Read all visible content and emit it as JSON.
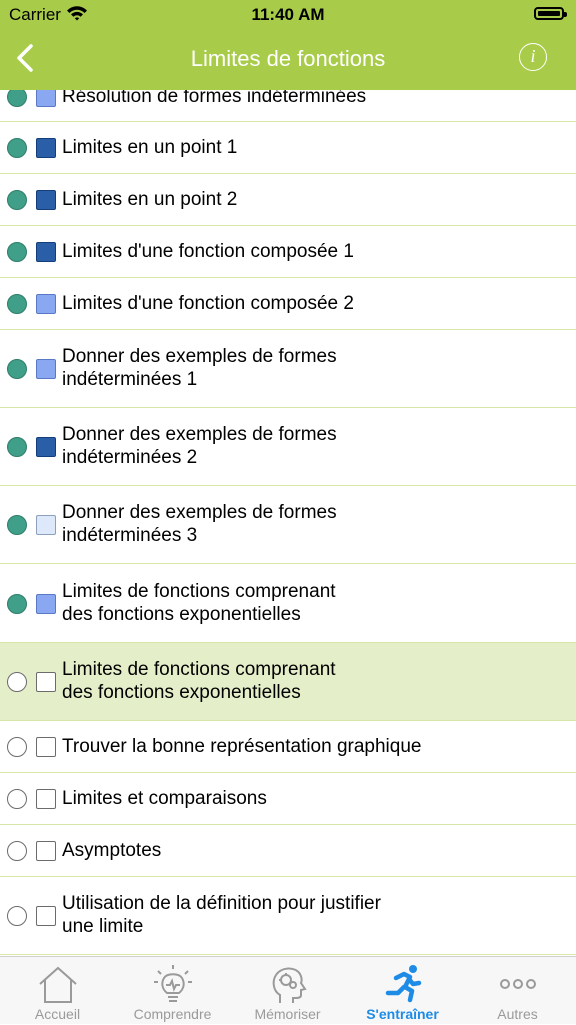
{
  "status_bar": {
    "carrier": "Carrier",
    "time": "11:40 AM"
  },
  "header": {
    "title": "Limites de fonctions",
    "back_icon": "chevron-left-icon",
    "info_icon": "info-icon"
  },
  "colors": {
    "header_bg": "#a8cc4a",
    "completed_dot": "#3f9f88",
    "selected_row_bg": "#e4efc9",
    "active_tab": "#1e8ce6",
    "inactive_tab": "#9a9a9a"
  },
  "items": [
    {
      "line1": "Résolution de formes indéterminées",
      "line2": "",
      "completed": true,
      "level": "medium",
      "selected": false
    },
    {
      "line1": "Limites en un point 1",
      "line2": "",
      "completed": true,
      "level": "dark",
      "selected": false
    },
    {
      "line1": "Limites en un point 2",
      "line2": "",
      "completed": true,
      "level": "dark",
      "selected": false
    },
    {
      "line1": "Limites d'une fonction composée 1",
      "line2": "",
      "completed": true,
      "level": "dark",
      "selected": false
    },
    {
      "line1": "Limites d'une fonction composée 2",
      "line2": "",
      "completed": true,
      "level": "medium",
      "selected": false
    },
    {
      "line1": "Donner des exemples de formes",
      "line2": "indéterminées 1",
      "completed": true,
      "level": "medium",
      "selected": false
    },
    {
      "line1": "Donner des exemples de formes",
      "line2": "indéterminées 2",
      "completed": true,
      "level": "dark",
      "selected": false
    },
    {
      "line1": "Donner des exemples de formes",
      "line2": "indéterminées 3",
      "completed": true,
      "level": "light",
      "selected": false
    },
    {
      "line1": "Limites de fonctions comprenant",
      "line2": "des fonctions exponentielles",
      "completed": true,
      "level": "medium",
      "selected": false
    },
    {
      "line1": "Limites de fonctions comprenant",
      "line2": "des fonctions exponentielles",
      "completed": false,
      "level": "empty",
      "selected": true
    },
    {
      "line1": "Trouver la bonne représentation graphique",
      "line2": "",
      "completed": false,
      "level": "empty",
      "selected": false
    },
    {
      "line1": "Limites et comparaisons",
      "line2": "",
      "completed": false,
      "level": "empty",
      "selected": false
    },
    {
      "line1": "Asymptotes",
      "line2": "",
      "completed": false,
      "level": "empty",
      "selected": false
    },
    {
      "line1": "Utilisation de la définition pour justifier",
      "line2": "une limite",
      "completed": false,
      "level": "empty",
      "selected": false
    }
  ],
  "tabs": [
    {
      "label": "Accueil",
      "icon": "home-icon",
      "active": false
    },
    {
      "label": "Comprendre",
      "icon": "lightbulb-icon",
      "active": false
    },
    {
      "label": "Mémoriser",
      "icon": "brain-head-icon",
      "active": false
    },
    {
      "label": "S'entraîner",
      "icon": "running-icon",
      "active": true
    },
    {
      "label": "Autres",
      "icon": "more-icon",
      "active": false
    }
  ]
}
